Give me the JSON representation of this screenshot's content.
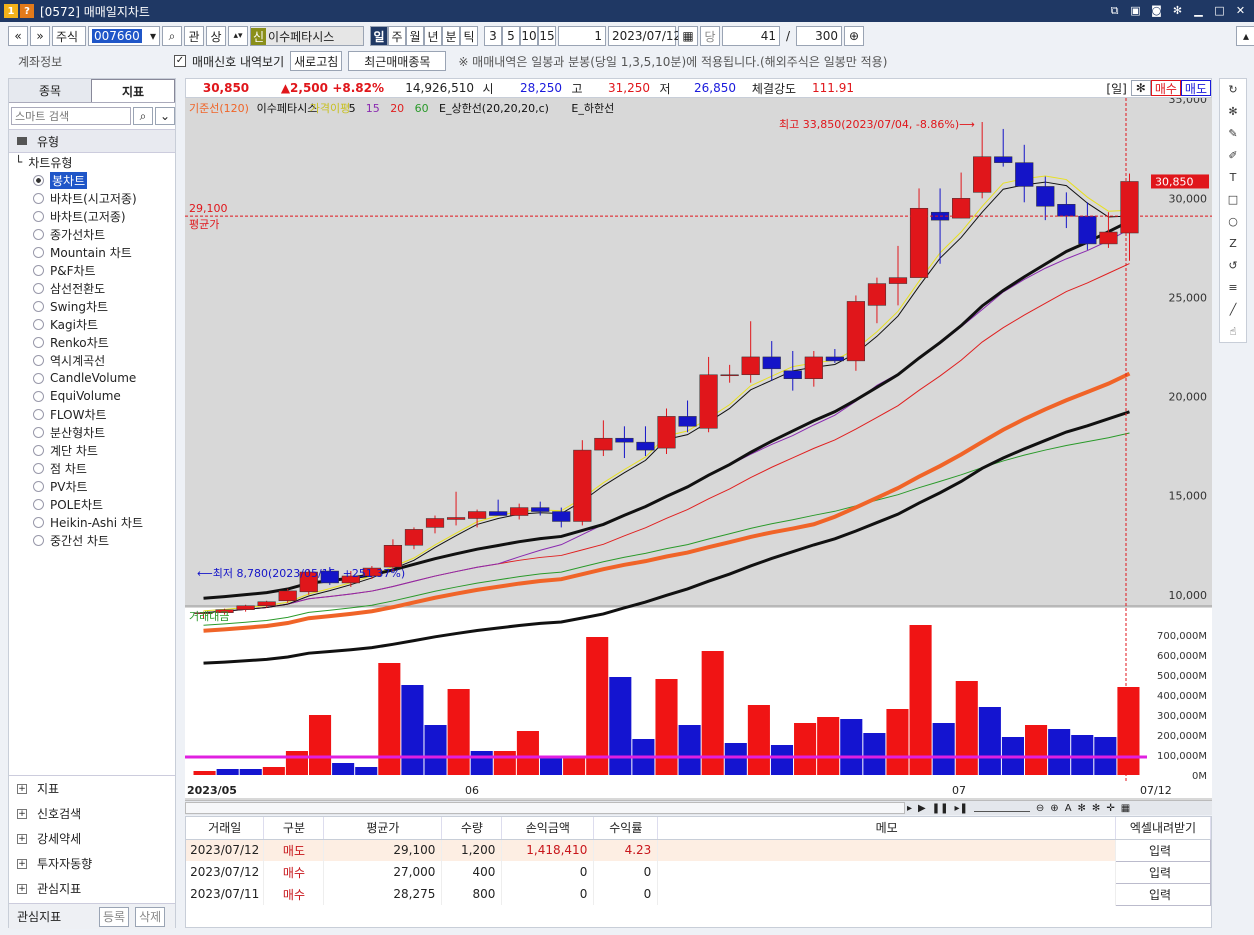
{
  "window": {
    "badge1": "1",
    "badge2": "?",
    "title": "[0572] 매매일지차트"
  },
  "toolbar": {
    "nav_prev": "«",
    "nav_up": "»",
    "market": "주식",
    "code": "007660",
    "search": "⌕",
    "gwan": "관",
    "sang": "상",
    "sin_badge": "신",
    "stock_name": "이수페타시스",
    "periods": [
      "일",
      "주",
      "월",
      "년",
      "분",
      "틱"
    ],
    "period_active": "일",
    "intervals": [
      "3",
      "5",
      "10",
      "15"
    ],
    "count_sel": "1",
    "date": "2023/07/12",
    "dang": "당",
    "bars": "41",
    "slash": "/",
    "max_bars": "300"
  },
  "toolbar2": {
    "account_label": "계좌정보",
    "signal_label": "매매신호 내역보기",
    "refresh": "새로고침",
    "recent": "최근매매종목",
    "notice": "※ 매매내역은 일봉과 분봉(당일 1,3,5,10분)에 적용됩니다.(해외주식은 일봉만 적용)"
  },
  "left": {
    "tabs": [
      "종목",
      "지표"
    ],
    "search_placeholder": "스마트 검색",
    "group": "유형",
    "section": "차트유형",
    "chart_types": [
      "봉차트",
      "바차트(시고저종)",
      "바차트(고저종)",
      "종가선차트",
      "Mountain 차트",
      "P&F차트",
      "삼선전환도",
      "Swing차트",
      "Kagi차트",
      "Renko차트",
      "역시계곡선",
      "CandleVolume",
      "EquiVolume",
      "FLOW차트",
      "분산형차트",
      "계단 차트",
      "점 차트",
      "PV차트",
      "POLE차트",
      "Heikin-Ashi 차트",
      "중간선 차트"
    ],
    "selected": "봉차트",
    "bottom": [
      "지표",
      "신호검색",
      "강세약세",
      "투자자동향",
      "관심지표"
    ],
    "fav_label": "관심지표",
    "fav_add": "등록",
    "fav_del": "삭제"
  },
  "quote": {
    "price": "30,850",
    "change": "▲2,500",
    "pct": "+8.82%",
    "volume": "14,926,510",
    "open_l": "시",
    "open": "28,250",
    "high_l": "고",
    "high": "31,250",
    "low_l": "저",
    "low": "26,850",
    "str_l": "체결강도",
    "str": "111.91",
    "period_tag": "[일]",
    "buy": "매수",
    "sell": "매도"
  },
  "chart_data": {
    "type": "candlestick",
    "legend": [
      "기준선(120)",
      "이수페타시스",
      "가격이평",
      "5",
      "15",
      "20",
      "60",
      "E_상한선(20,20,20,c)",
      "E_하한선"
    ],
    "price_ticks": [
      "35,000",
      "30,000",
      "25,000",
      "20,000",
      "15,000",
      "10,000"
    ],
    "avg_price_label": "29,100",
    "avg_label": "평균가",
    "high_note": "최고 33,850(2023/07/04, -8.86%)⟶",
    "low_note": "⟵최저 8,780(2023/05/15, +251.37%)",
    "last_price": "30,850",
    "candles": [
      [
        9050,
        9150,
        8780,
        9100
      ],
      [
        9100,
        9300,
        9000,
        9250
      ],
      [
        9250,
        9500,
        9150,
        9450
      ],
      [
        9450,
        9700,
        9350,
        9650
      ],
      [
        9700,
        10300,
        9600,
        10200
      ],
      [
        10150,
        11300,
        10000,
        11150
      ],
      [
        11200,
        11400,
        10500,
        10600
      ],
      [
        10600,
        11200,
        10400,
        10950
      ],
      [
        10950,
        11450,
        10800,
        11350
      ],
      [
        11400,
        12800,
        11200,
        12500
      ],
      [
        12500,
        13400,
        12300,
        13300
      ],
      [
        13400,
        14000,
        13100,
        13850
      ],
      [
        13800,
        15200,
        13500,
        13900
      ],
      [
        13850,
        14300,
        13400,
        14200
      ],
      [
        14200,
        14800,
        14000,
        14000
      ],
      [
        14000,
        14600,
        13800,
        14400
      ],
      [
        14400,
        14700,
        14000,
        14200
      ],
      [
        14200,
        14400,
        13400,
        13700
      ],
      [
        13700,
        17800,
        13500,
        17300
      ],
      [
        17300,
        18800,
        17000,
        17900
      ],
      [
        17900,
        18500,
        16900,
        17700
      ],
      [
        17700,
        18500,
        17000,
        17300
      ],
      [
        17400,
        19400,
        17100,
        19000
      ],
      [
        19000,
        19800,
        18200,
        18500
      ],
      [
        18400,
        22000,
        18200,
        21100
      ],
      [
        21100,
        21600,
        20700,
        21100
      ],
      [
        21100,
        23800,
        20700,
        22000
      ],
      [
        22000,
        22800,
        20800,
        21400
      ],
      [
        21300,
        22300,
        20300,
        20900
      ],
      [
        20900,
        22300,
        20500,
        22000
      ],
      [
        22000,
        22400,
        21700,
        21800
      ],
      [
        21800,
        25100,
        21300,
        24800
      ],
      [
        24600,
        26000,
        23700,
        25700
      ],
      [
        25700,
        27600,
        24600,
        26000
      ],
      [
        26000,
        30500,
        26000,
        29500
      ],
      [
        29300,
        30500,
        26700,
        28900
      ],
      [
        29000,
        31300,
        29000,
        30000
      ],
      [
        30300,
        33850,
        30000,
        32100
      ],
      [
        32100,
        33500,
        31600,
        31800
      ],
      [
        31800,
        32700,
        29800,
        30600
      ],
      [
        30600,
        31100,
        28900,
        29600
      ],
      [
        29700,
        30300,
        28500,
        29100
      ],
      [
        29100,
        29800,
        27400,
        27700
      ],
      [
        27700,
        29300,
        27500,
        28300
      ],
      [
        28250,
        31250,
        26850,
        30850
      ]
    ],
    "volume_label": "거래대금",
    "volume_ticks": [
      "700,000M",
      "600,000M",
      "500,000M",
      "400,000M",
      "300,000M",
      "200,000M",
      "100,000M",
      "0M"
    ],
    "volume": [
      [
        20,
        1
      ],
      [
        30,
        0
      ],
      [
        30,
        0
      ],
      [
        40,
        1
      ],
      [
        120,
        1
      ],
      [
        300,
        1
      ],
      [
        60,
        0
      ],
      [
        40,
        0
      ],
      [
        560,
        1
      ],
      [
        450,
        0
      ],
      [
        250,
        0
      ],
      [
        430,
        1
      ],
      [
        120,
        0
      ],
      [
        120,
        1
      ],
      [
        220,
        1
      ],
      [
        90,
        0
      ],
      [
        90,
        1
      ],
      [
        690,
        1
      ],
      [
        490,
        0
      ],
      [
        180,
        0
      ],
      [
        480,
        1
      ],
      [
        250,
        0
      ],
      [
        620,
        1
      ],
      [
        160,
        0
      ],
      [
        350,
        1
      ],
      [
        150,
        0
      ],
      [
        260,
        1
      ],
      [
        290,
        1
      ],
      [
        280,
        0
      ],
      [
        210,
        0
      ],
      [
        330,
        1
      ],
      [
        750,
        1
      ],
      [
        260,
        0
      ],
      [
        470,
        1
      ],
      [
        340,
        0
      ],
      [
        190,
        0
      ],
      [
        250,
        1
      ],
      [
        230,
        0
      ],
      [
        200,
        0
      ],
      [
        190,
        0
      ],
      [
        440,
        1
      ]
    ],
    "x_ticks": [
      "2023/05",
      "06",
      "07",
      "07/12"
    ]
  },
  "trades": {
    "headers": [
      "거래일",
      "구분",
      "평균가",
      "수량",
      "손익금액",
      "수익률",
      "메모",
      "엑셀내려받기"
    ],
    "rows": [
      {
        "date": "2023/07/12",
        "side": "매도",
        "avg": "29,100",
        "qty": "1,200",
        "pnl": "1,418,410",
        "ret": "4.23",
        "btn": "입력"
      },
      {
        "date": "2023/07/12",
        "side": "매수",
        "avg": "27,000",
        "qty": "400",
        "pnl": "0",
        "ret": "0",
        "btn": "입력"
      },
      {
        "date": "2023/07/11",
        "side": "매수",
        "avg": "28,275",
        "qty": "800",
        "pnl": "0",
        "ret": "0",
        "btn": "입력"
      }
    ]
  }
}
